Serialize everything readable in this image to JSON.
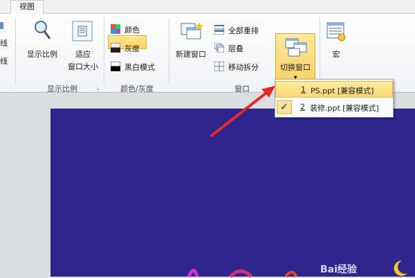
{
  "tab": {
    "label": "视图"
  },
  "ribbon": {
    "left_partial": {
      "line1": "线",
      "line2": "线"
    },
    "show_ratio": {
      "zoom_label": "显示比例",
      "fit_label_1": "适应",
      "fit_label_2": "窗口大小",
      "group_label": "显示比例"
    },
    "color": {
      "color_label": "颜色",
      "gray_label": "灰度",
      "bw_label": "黑白模式",
      "group_label": "颜色/灰度"
    },
    "window": {
      "new_window_label": "新建窗口",
      "arrange_all_label": "全部重排",
      "cascade_label": "层叠",
      "move_split_label": "移动拆分",
      "switch_window_label": "切换窗口",
      "switch_arrow": "▾",
      "group_label": "窗口"
    },
    "macro": {
      "label": "宏"
    }
  },
  "dropdown": {
    "items": [
      {
        "number": "1",
        "text": "PS.ppt [兼容模式]",
        "checked": false
      },
      {
        "number": "2",
        "text": "装修.ppt [兼容模式]",
        "checked": true
      }
    ],
    "check_glyph": "✓"
  },
  "watermark": {
    "text": "Bai经验"
  },
  "colors": {
    "slide_bg": "#2e268d",
    "arrow": "#e02a2a",
    "highlight": "#fbd25a"
  }
}
